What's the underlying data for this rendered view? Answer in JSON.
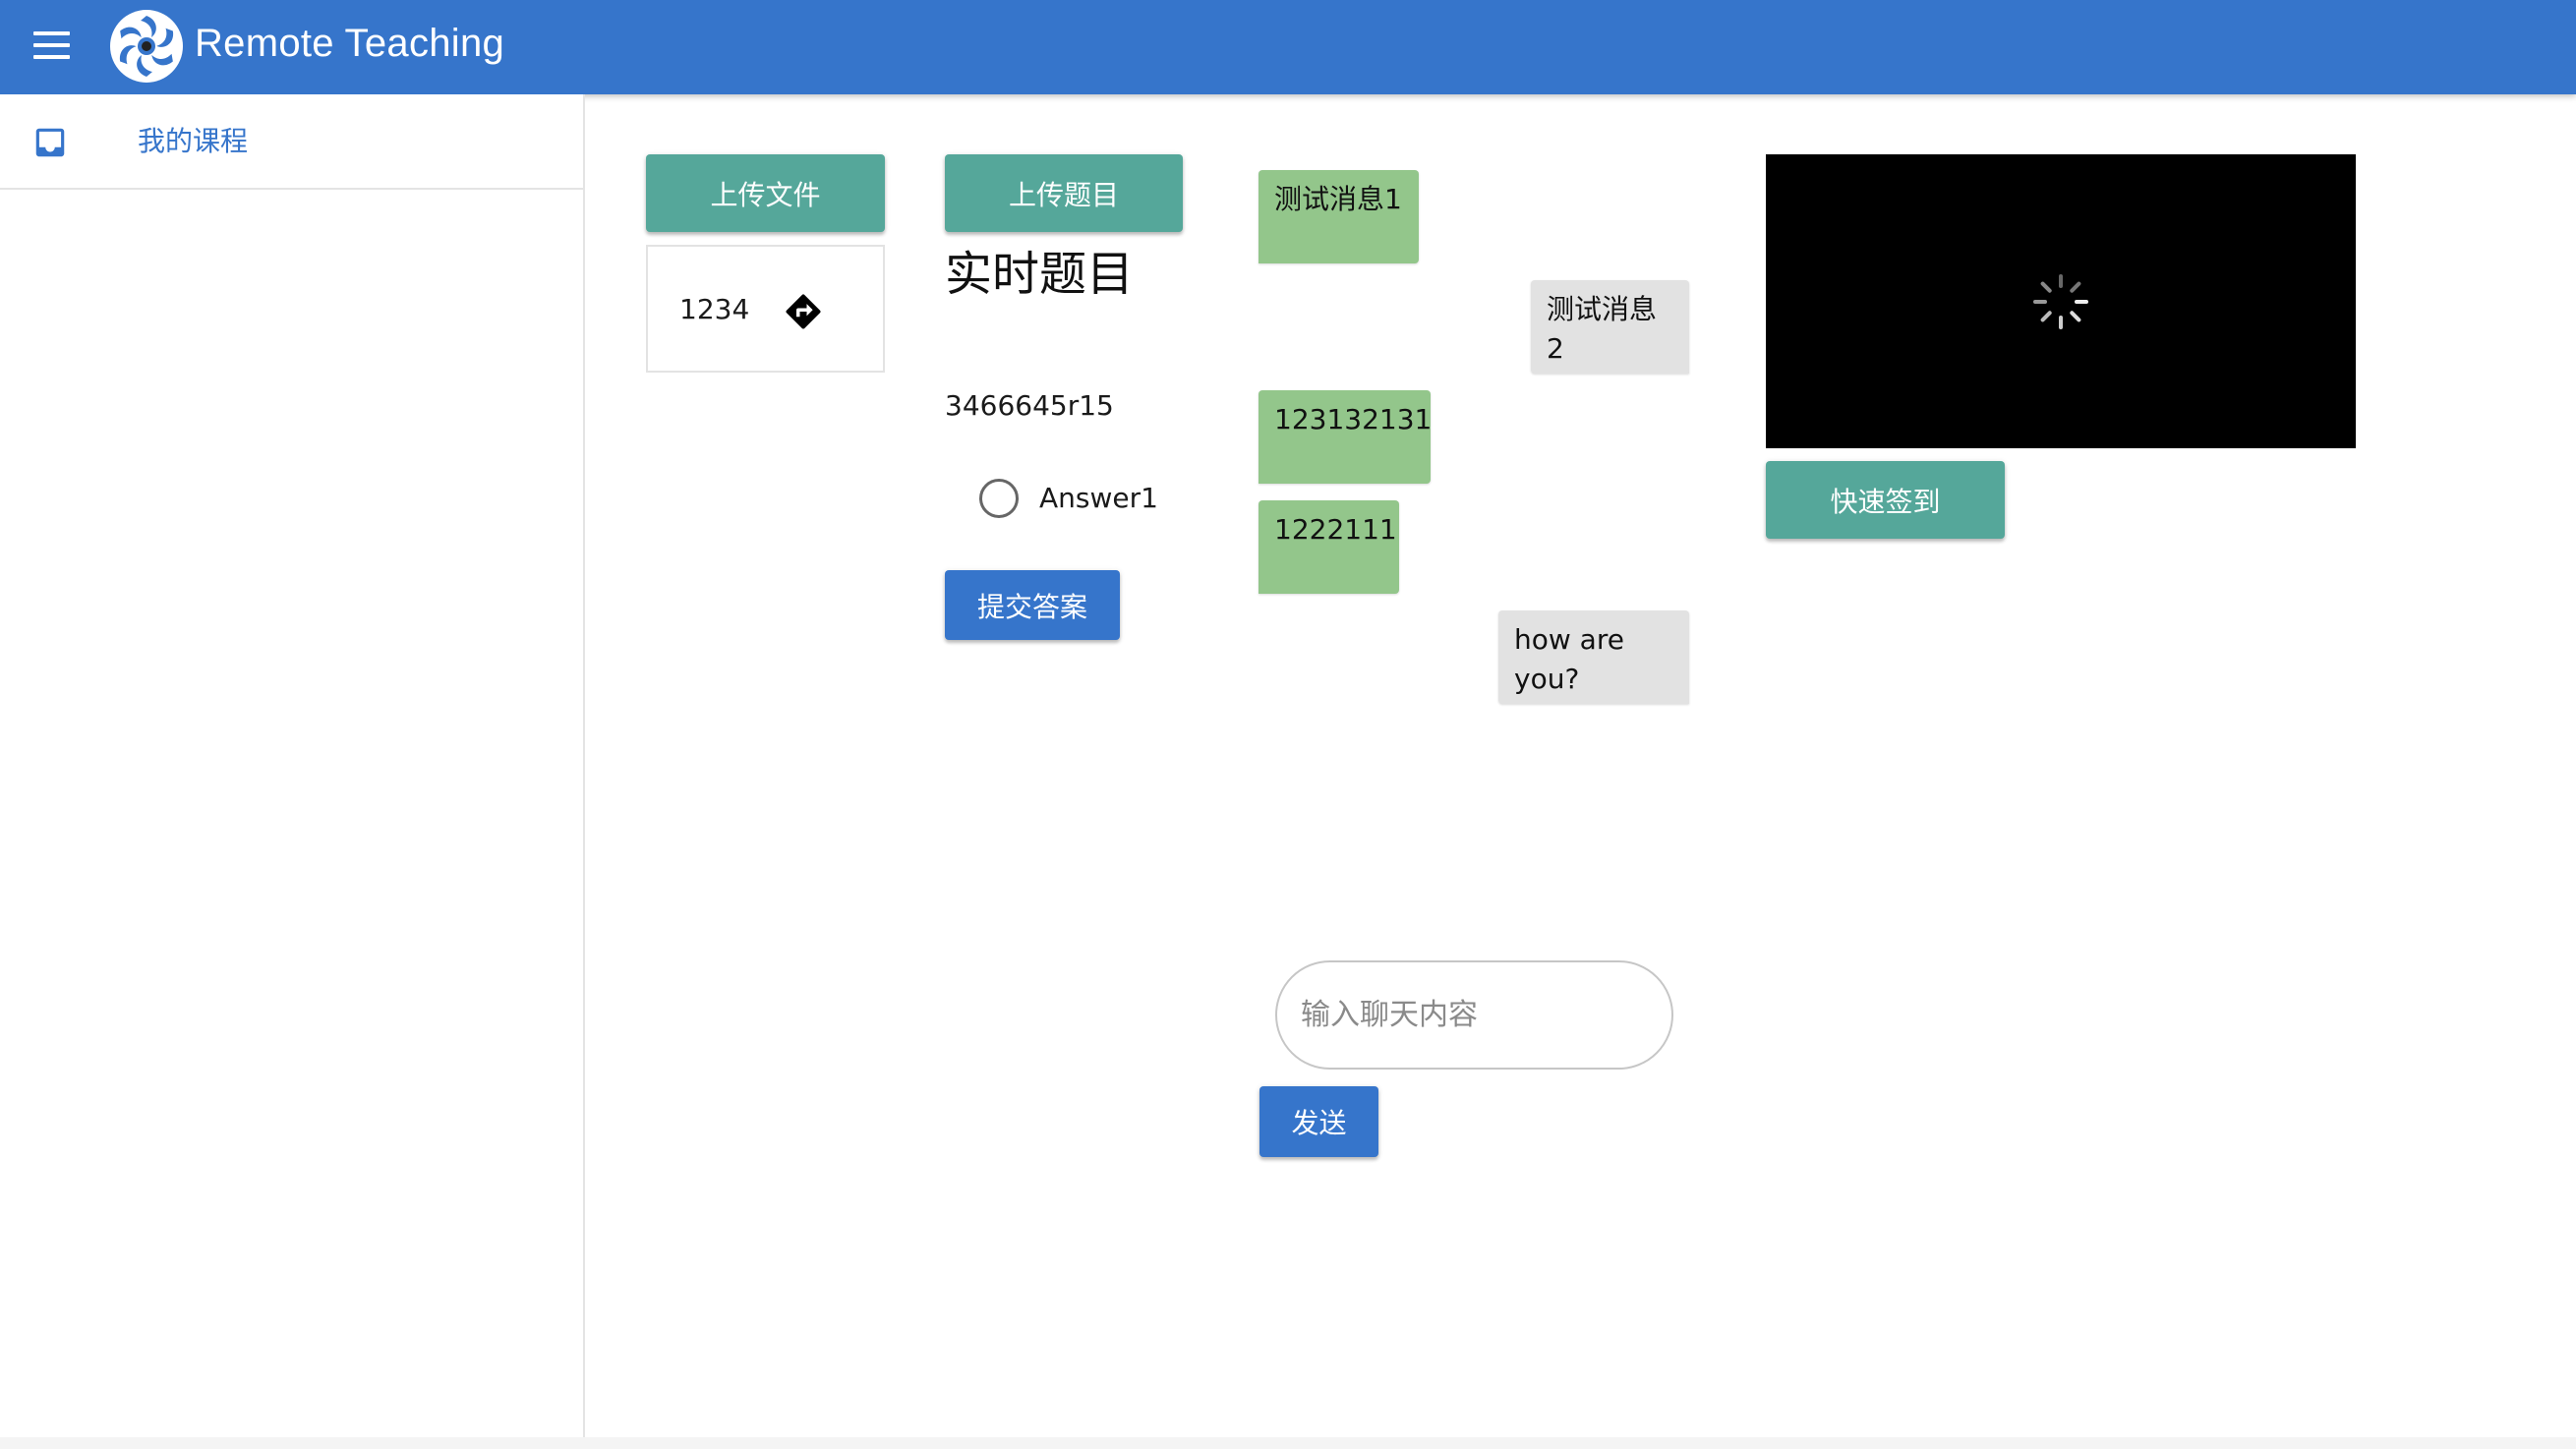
{
  "header": {
    "title": "Remote Teaching",
    "color": "#3675cb"
  },
  "sidebar": {
    "items": [
      {
        "label": "我的课程",
        "icon": "inbox-icon"
      }
    ]
  },
  "files": {
    "upload_label": "上传文件",
    "items": [
      {
        "name": "1234",
        "icon": "directions-icon"
      }
    ]
  },
  "question": {
    "upload_label": "上传题目",
    "title": "实时题目",
    "text": "3466645r15",
    "options": [
      "Answer1"
    ],
    "submit_label": "提交答案"
  },
  "chat": {
    "messages": [
      {
        "text": "测试消息1",
        "side": "sent"
      },
      {
        "text": "测试消息2",
        "side": "received"
      },
      {
        "text": "123132131",
        "side": "sent"
      },
      {
        "text": "1222111",
        "side": "sent"
      },
      {
        "text": "how are you?",
        "side": "received"
      }
    ],
    "input_placeholder": "输入聊天内容",
    "send_label": "发送"
  },
  "video": {
    "checkin_label": "快速签到"
  },
  "colors": {
    "primary": "#3675cb",
    "teal": "#55a79a",
    "sent_bubble": "#93c68b",
    "received_bubble": "#e2e2e2"
  }
}
